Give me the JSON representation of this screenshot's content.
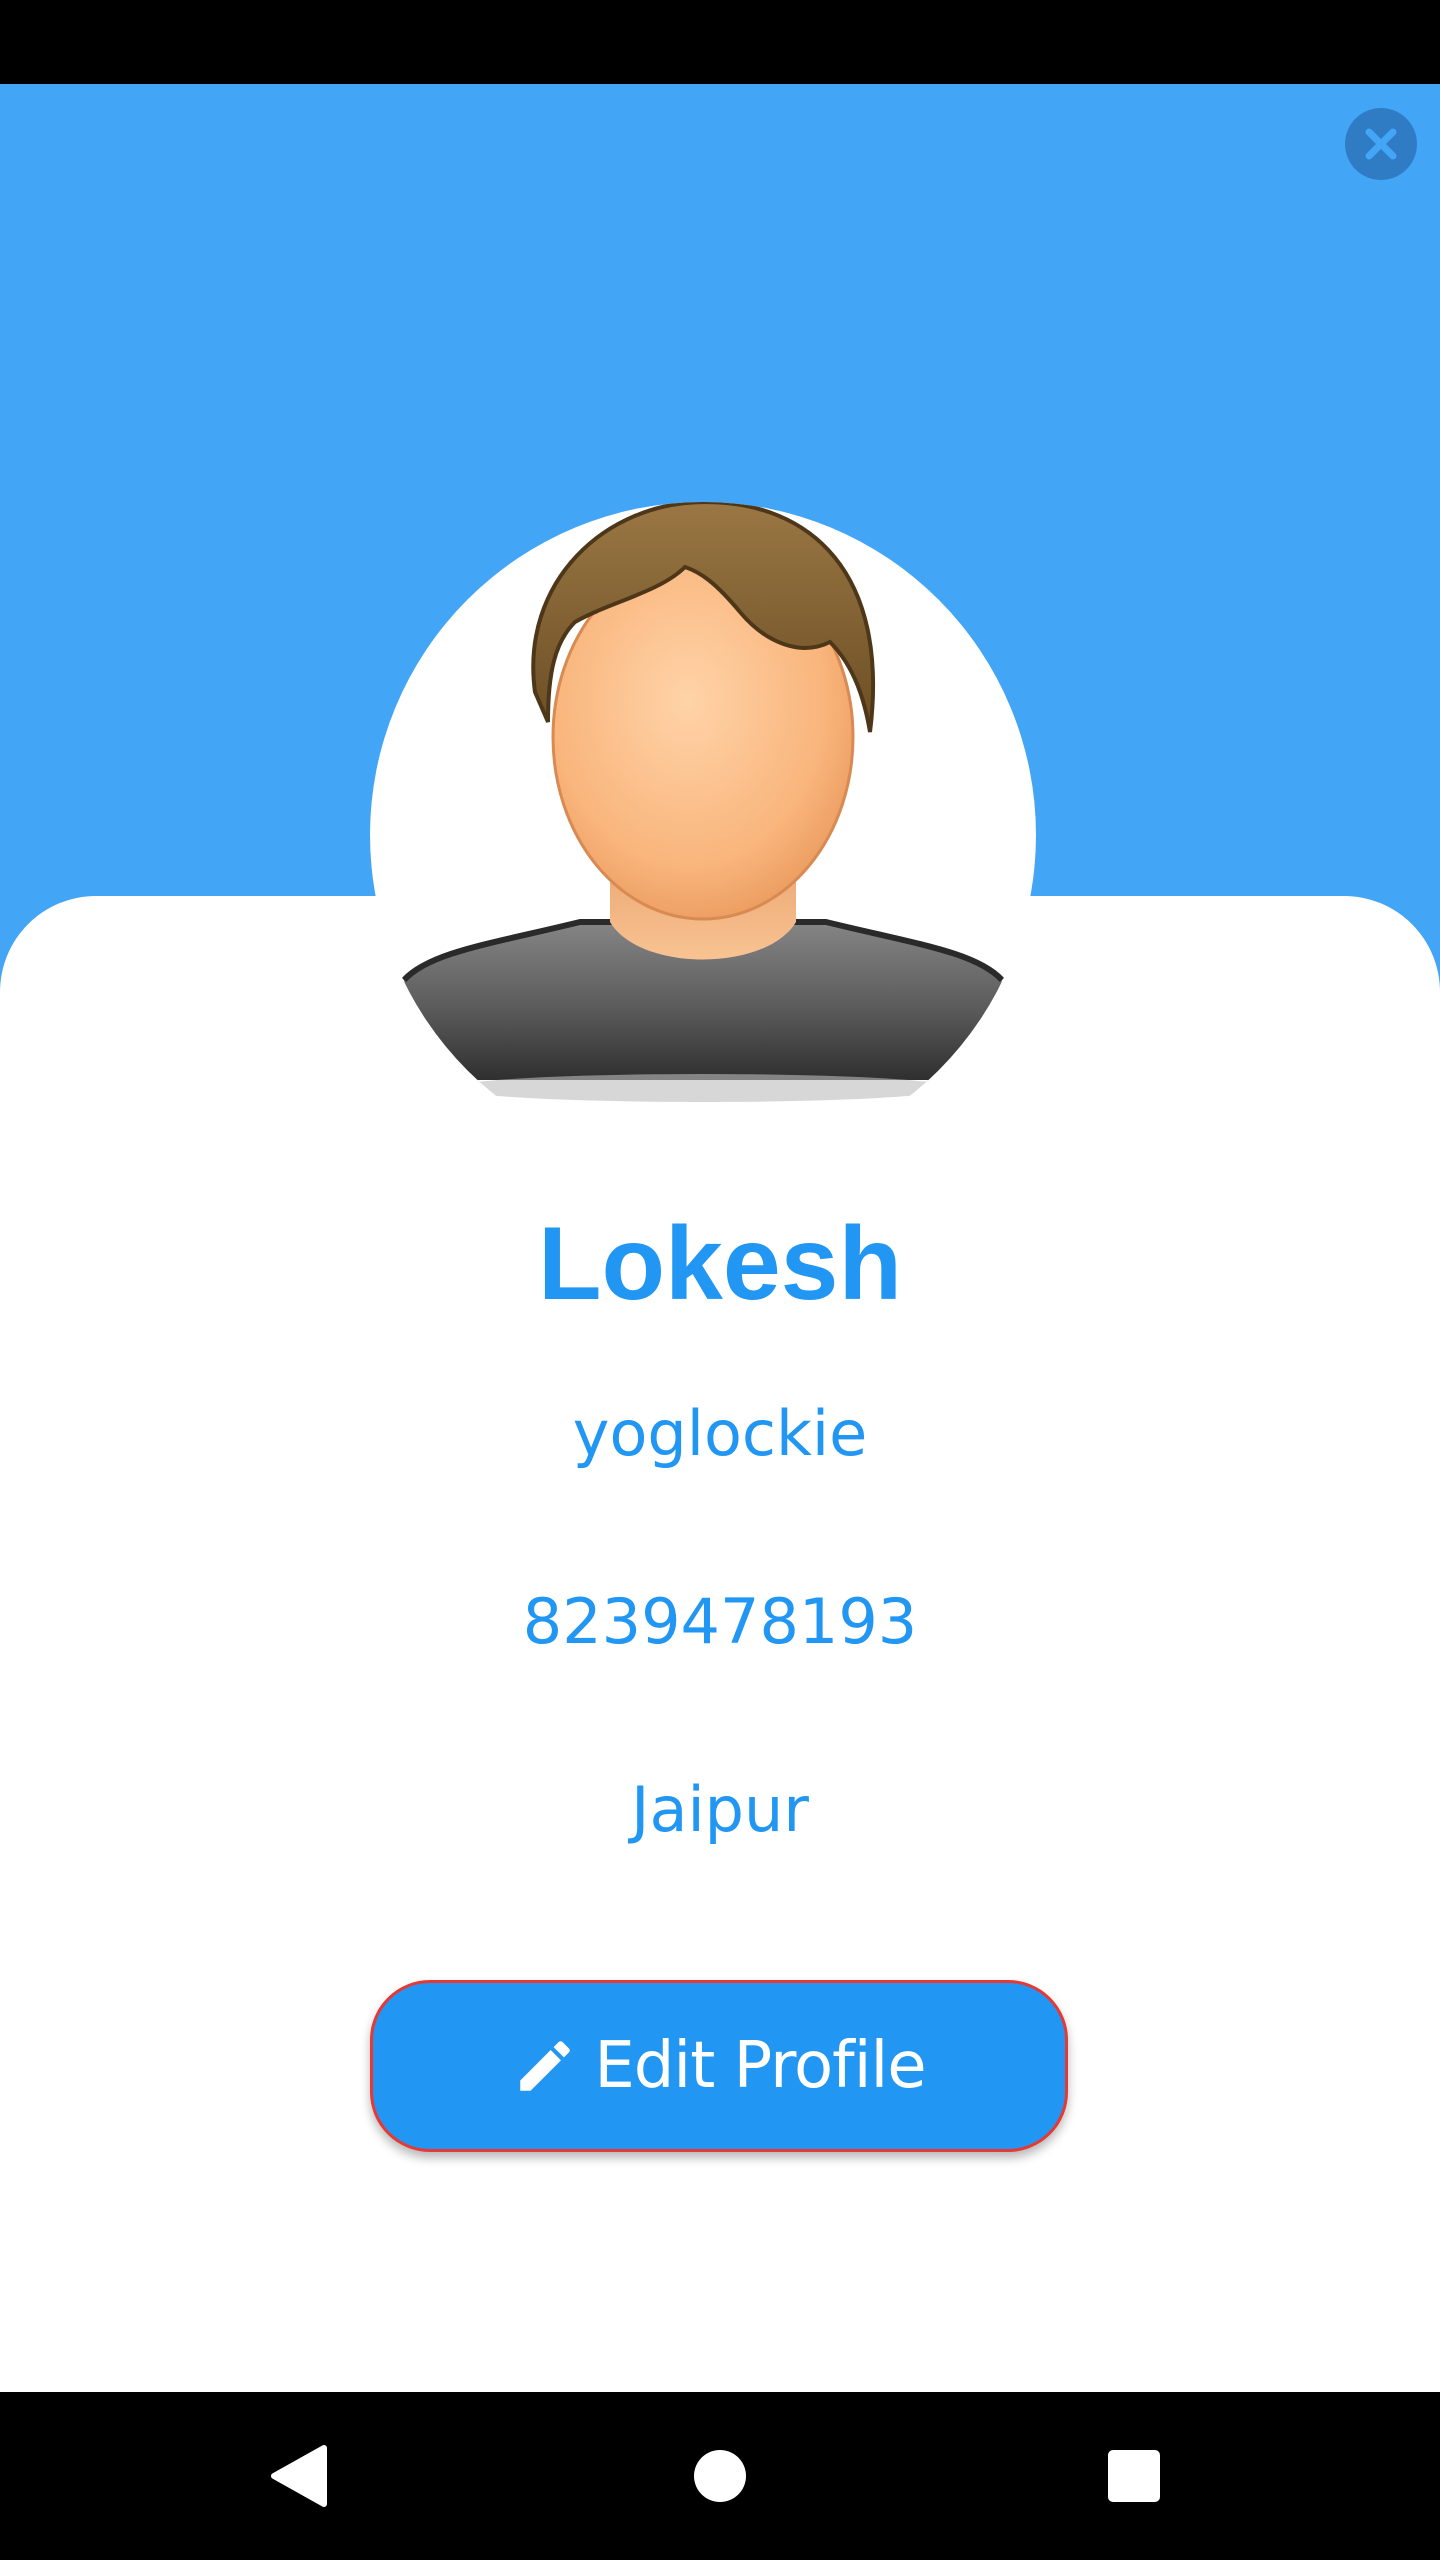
{
  "icons": {
    "close": "close-icon",
    "avatar": "user-avatar",
    "edit": "pencil-icon",
    "nav_back": "back-triangle-icon",
    "nav_home": "home-circle-icon",
    "nav_recents": "recents-square-icon"
  },
  "colors": {
    "header_background": "#42A5F5",
    "accent": "#2196F3",
    "button_border": "#E53935",
    "card_background": "#FFFFFF"
  },
  "profile": {
    "name": "Lokesh",
    "username": "yoglockie",
    "phone": "8239478193",
    "city": "Jaipur"
  },
  "actions": {
    "edit_label": "Edit Profile"
  }
}
